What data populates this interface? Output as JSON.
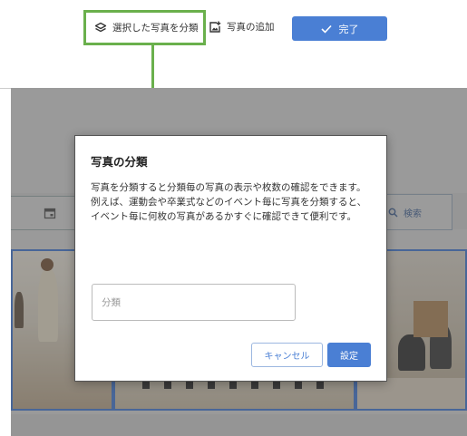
{
  "toolbar": {
    "classify_label": "選択した写真を分類",
    "add_photo_label": "写真の追加",
    "done_label": "完了"
  },
  "background": {
    "search_label": "検索"
  },
  "dialog": {
    "title": "写真の分類",
    "description_line1": "写真を分類すると分類毎の写真の表示や枚数の確認をできます。",
    "description_line2": "例えば、運動会や卒業式などのイベント毎に写真を分類すると、イベント毎に何枚の写真があるかすぐに確認できて便利です。",
    "input_placeholder": "分類",
    "input_value": "",
    "cancel_label": "キャンセル",
    "ok_label": "設定"
  },
  "colors": {
    "accent": "#4a7fd4",
    "highlight": "#6ab04c"
  }
}
